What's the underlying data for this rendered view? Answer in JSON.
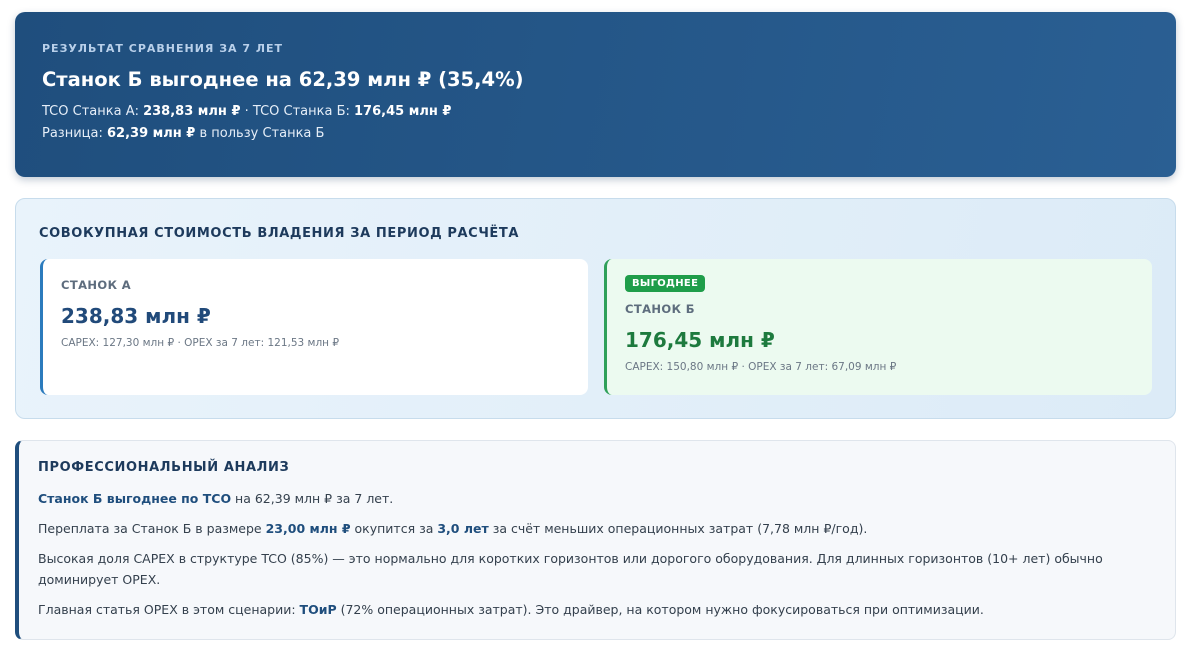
{
  "banner": {
    "eyebrow": "РЕЗУЛЬТАТ СРАВНЕНИЯ ЗА 7 ЛЕТ",
    "headline": "Станок Б выгоднее на 62,39 млн ₽ (35,4%)",
    "tco_a_label": "TCO Станка А: ",
    "tco_a_value": "238,83 млн ₽",
    "separator": " · TCO Станка Б: ",
    "tco_b_value": "176,45 млн ₽",
    "diff_label": "Разница: ",
    "diff_value": "62,39 млн ₽",
    "diff_suffix": " в пользу Станка Б"
  },
  "tco": {
    "title": "СОВОКУПНАЯ СТОИМОСТЬ ВЛАДЕНИЯ ЗА ПЕРИОД РАСЧЁТА",
    "machine_a": {
      "name": "СТАНОК А",
      "amount": "238,83 млн ₽",
      "detail": "CAPEX: 127,30 млн ₽ · OPEX за 7 лет: 121,53 млн ₽"
    },
    "machine_b": {
      "badge": "ВЫГОДНЕЕ",
      "name": "СТАНОК Б",
      "amount": "176,45 млн ₽",
      "detail": "CAPEX: 150,80 млн ₽ · OPEX за 7 лет: 67,09 млн ₽"
    }
  },
  "analysis": {
    "title": "ПРОФЕССИОНАЛЬНЫЙ АНАЛИЗ",
    "p1": {
      "strong": "Станок Б выгоднее по TCO",
      "rest": " на 62,39 млн ₽ за 7 лет."
    },
    "p2": {
      "t1": "Переплата за Станок Б в размере ",
      "s1": "23,00 млн ₽",
      "t2": " окупится за ",
      "s2": "3,0 лет",
      "t3": " за счёт меньших операционных затрат (7,78 млн ₽/год)."
    },
    "p3": "Высокая доля CAPEX в структуре TCO (85%) — это нормально для коротких горизонтов или дорогого оборудования. Для длинных горизонтов (10+ лет) обычно доминирует OPEX.",
    "p4": {
      "t1": "Главная статья OPEX в этом сценарии: ",
      "s1": "ТОиР",
      "t2": " (72% операционных затрат). Это драйвер, на котором нужно фокусироваться при оптимизации."
    }
  },
  "colors": {
    "banner": "#1f4e7d",
    "accent_blue": "#2b7bbd",
    "accent_green": "#1f9d4a",
    "panel_bg": "#e9f3fb",
    "analysis_bg": "#f6f8fb"
  }
}
